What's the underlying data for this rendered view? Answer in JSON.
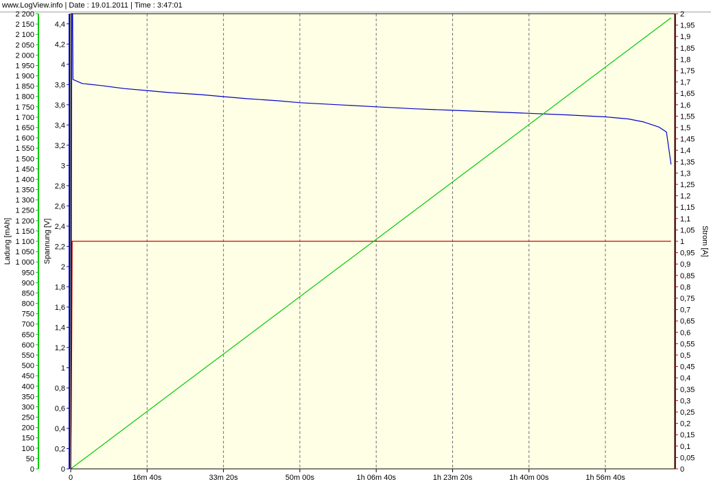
{
  "header": {
    "site": "www.LogView.info",
    "separator": "|",
    "date": "Date : 19.01.2011",
    "time": "Time : 3:47:01"
  },
  "chart_data": {
    "type": "line",
    "x": {
      "unit": "seconds",
      "range": [
        0,
        7140
      ],
      "ticks": [
        {
          "value": 0,
          "label": "0"
        },
        {
          "value": 1000,
          "label": "16m 40s"
        },
        {
          "value": 2000,
          "label": "33m 20s"
        },
        {
          "value": 3000,
          "label": "50m 00s"
        },
        {
          "value": 4000,
          "label": "1h 06m 40s"
        },
        {
          "value": 5000,
          "label": "1h 23m 20s"
        },
        {
          "value": 6000,
          "label": "1h 40m 00s"
        },
        {
          "value": 7000,
          "label": "1h 56m 40s"
        }
      ]
    },
    "axes": {
      "charge": {
        "label": "Ladung [mAh]",
        "color": "#00c800",
        "min": 0,
        "max": 2200,
        "step": 50,
        "tick_labels": [
          "0",
          "50",
          "100",
          "150",
          "200",
          "250",
          "300",
          "350",
          "400",
          "450",
          "500",
          "550",
          "600",
          "650",
          "700",
          "750",
          "800",
          "850",
          "900",
          "950",
          "1 000",
          "1 050",
          "1 100",
          "1 150",
          "1 200",
          "1 250",
          "1 300",
          "1 350",
          "1 400",
          "1 450",
          "1 500",
          "1 550",
          "1 600",
          "1 650",
          "1 700",
          "1 750",
          "1 800",
          "1 850",
          "1 900",
          "1 950",
          "2 000",
          "2 050",
          "2 100",
          "2 150",
          "2 200"
        ]
      },
      "voltage": {
        "label": "Spannung [V]",
        "color": "#0000c8",
        "min": 0,
        "max": 4.5,
        "step": 0.2,
        "tick_labels": [
          "0",
          "0,2",
          "0,4",
          "0,6",
          "0,8",
          "1",
          "1,2",
          "1,4",
          "1,6",
          "1,8",
          "2",
          "2,2",
          "2,4",
          "2,6",
          "2,8",
          "3",
          "3,2",
          "3,4",
          "3,6",
          "3,8",
          "4",
          "4,2",
          "4,4"
        ]
      },
      "current": {
        "label": "Strom [A]",
        "color": "#c80000",
        "min": 0,
        "max": 2,
        "step": 0.05,
        "tick_labels": [
          "0",
          "0,05",
          "0,1",
          "0,15",
          "0,2",
          "0,25",
          "0,3",
          "0,35",
          "0,4",
          "0,45",
          "0,5",
          "0,55",
          "0,6",
          "0,65",
          "0,7",
          "0,75",
          "0,8",
          "0,85",
          "0,9",
          "0,95",
          "1",
          "1,05",
          "1,1",
          "1,15",
          "1,2",
          "1,25",
          "1,3",
          "1,35",
          "1,4",
          "1,45",
          "1,5",
          "1,55",
          "1,6",
          "1,65",
          "1,7",
          "1,75",
          "1,8",
          "1,85",
          "1,9",
          "1,95",
          "2"
        ]
      }
    },
    "grid": true,
    "background": "#ffffe6",
    "series": [
      {
        "axis": "voltage",
        "color": "#0000c8",
        "points": [
          [
            0,
            0
          ],
          [
            5,
            0.5
          ],
          [
            10,
            3.0
          ],
          [
            15,
            4.5
          ],
          [
            25,
            4.5
          ],
          [
            30,
            3.85
          ],
          [
            60,
            3.84
          ],
          [
            150,
            3.81
          ],
          [
            400,
            3.79
          ],
          [
            700,
            3.76
          ],
          [
            1000,
            3.74
          ],
          [
            1300,
            3.72
          ],
          [
            1700,
            3.7
          ],
          [
            2000,
            3.68
          ],
          [
            2300,
            3.66
          ],
          [
            2700,
            3.64
          ],
          [
            3000,
            3.62
          ],
          [
            3500,
            3.6
          ],
          [
            4000,
            3.58
          ],
          [
            4500,
            3.56
          ],
          [
            5000,
            3.545
          ],
          [
            5500,
            3.53
          ],
          [
            6000,
            3.515
          ],
          [
            6500,
            3.5
          ],
          [
            7000,
            3.48
          ],
          [
            7300,
            3.46
          ],
          [
            7500,
            3.43
          ],
          [
            7700,
            3.38
          ],
          [
            7800,
            3.33
          ],
          [
            7860,
            3.01
          ]
        ]
      },
      {
        "axis": "current",
        "color": "#c80000",
        "points": [
          [
            0,
            0
          ],
          [
            8,
            0.25
          ],
          [
            14,
            0.6
          ],
          [
            20,
            1.0
          ],
          [
            7860,
            1.0
          ]
        ]
      },
      {
        "axis": "charge",
        "color": "#00c800",
        "points": [
          [
            0,
            0
          ],
          [
            7860,
            2180
          ]
        ]
      }
    ]
  }
}
